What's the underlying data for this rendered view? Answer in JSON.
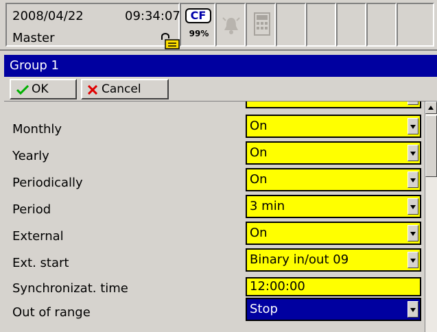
{
  "status": {
    "date": "2008/04/22",
    "time": "09:34:07",
    "user": "Master",
    "cf_label": "CF",
    "cf_percent": "99%"
  },
  "title": "Group 1",
  "toolbar": {
    "ok_label": "OK",
    "cancel_label": "Cancel"
  },
  "form": {
    "rows": [
      {
        "label": "Monthly",
        "value": "On"
      },
      {
        "label": "Yearly",
        "value": "On"
      },
      {
        "label": "Periodically",
        "value": "On"
      },
      {
        "label": "Period",
        "value": "3 min"
      },
      {
        "label": "External",
        "value": "On"
      },
      {
        "label": "Ext. start",
        "value": "Binary in/out 09"
      },
      {
        "label": "Synchronizat. time",
        "value": "12:00:00"
      },
      {
        "label": "Out of range",
        "value": "Stop"
      }
    ]
  },
  "colors": {
    "title_bg": "#0000a0",
    "field_bg": "#ffff00",
    "selected_bg": "#0000a0",
    "panel_bg": "#d6d3ce"
  },
  "icons": [
    "lock-icon",
    "cf-card-icon",
    "alarm-bell-icon",
    "calculator-icon",
    "check-icon",
    "cross-icon"
  ]
}
